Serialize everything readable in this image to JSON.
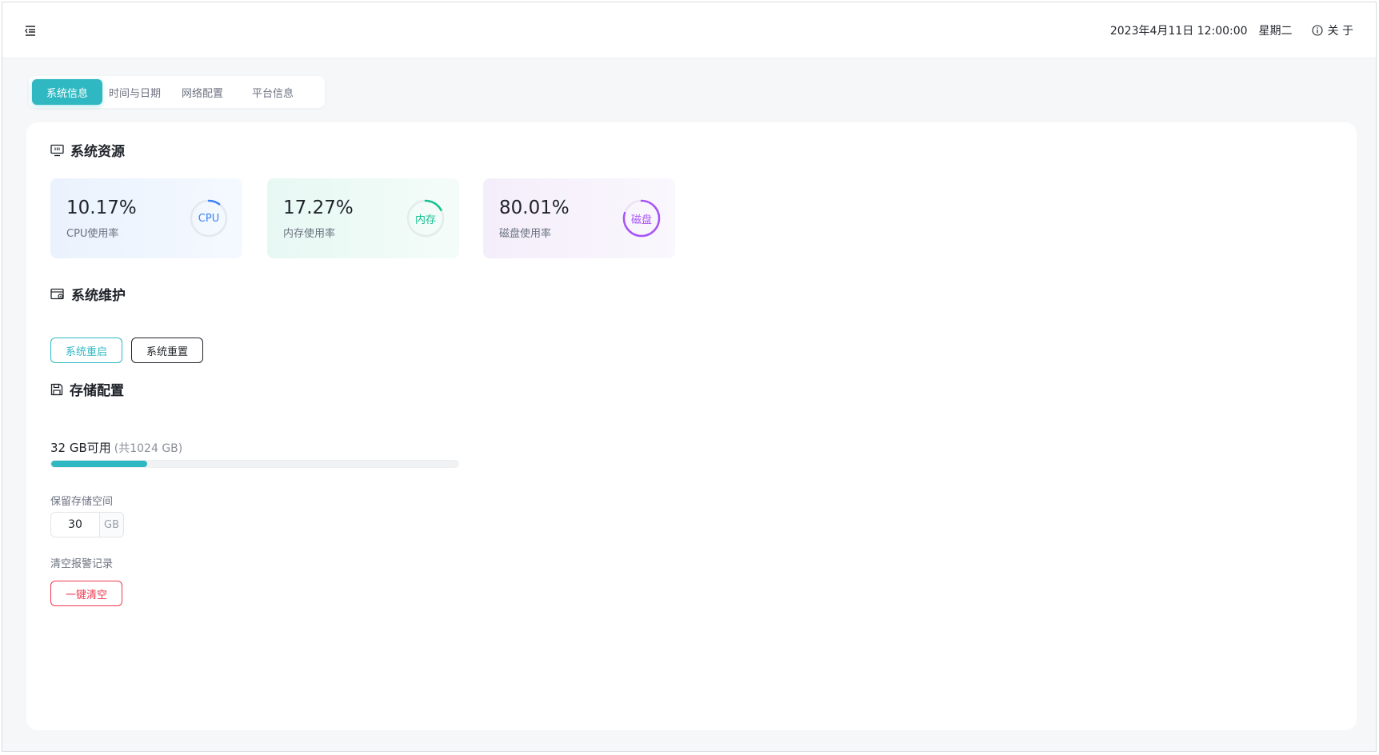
{
  "header": {
    "datetime": "2023年4月11日 12:00:00",
    "weekday": "星期二",
    "about_label": "关 于"
  },
  "tabs": [
    {
      "label": "系统信息",
      "active": true
    },
    {
      "label": "时间与日期",
      "active": false
    },
    {
      "label": "网络配置",
      "active": false
    },
    {
      "label": "平台信息",
      "active": false
    }
  ],
  "sections": {
    "resources": {
      "title": "系统资源",
      "icon": "monitor-icon"
    },
    "maintenance": {
      "title": "系统维护",
      "icon": "maintenance-icon"
    },
    "storage": {
      "title": "存储配置",
      "icon": "save-icon"
    }
  },
  "metrics": {
    "cpu": {
      "value": "10.17%",
      "label": "CPU使用率",
      "ring_text": "CPU",
      "percent": 10.17,
      "color": "#3b82f6"
    },
    "memory": {
      "value": "17.27%",
      "label": "内存使用率",
      "ring_text": "内存",
      "percent": 17.27,
      "color": "#10c28e"
    },
    "disk": {
      "value": "80.01%",
      "label": "磁盘使用率",
      "ring_text": "磁盘",
      "percent": 80.01,
      "color": "#a855f7"
    }
  },
  "maintenance": {
    "restart_label": "系统重启",
    "reset_label": "系统重置"
  },
  "storage": {
    "available": "32 GB可用",
    "total": "(共1024 GB)",
    "used_fraction": 0.235,
    "reserve_label": "保留存储空间",
    "reserve_value": "30",
    "reserve_unit": "GB",
    "clear_label": "清空报警记录",
    "clear_button": "一键清空"
  },
  "colors": {
    "accent": "#2fb8c2",
    "danger": "#f0384f"
  }
}
